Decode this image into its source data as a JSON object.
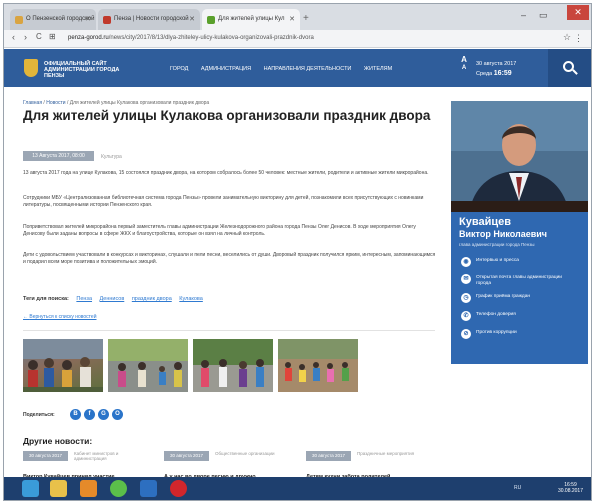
{
  "browser": {
    "tabs": [
      {
        "title": "О Пензенской городской",
        "favicon_color": "#d9a441"
      },
      {
        "title": "Пенза | Новости городской",
        "favicon_color": "#c0392b"
      },
      {
        "title": "Для жителей улицы Кул",
        "favicon_color": "#5aa02c"
      }
    ],
    "new_tab": "+",
    "window_controls": {
      "minimize": "–",
      "maximize": "▭",
      "close": "✕"
    },
    "nav": {
      "back": "‹",
      "forward": "›",
      "reload": "C",
      "home": "⊞",
      "apps": "☆"
    },
    "url_host": "penza-gorod.ru",
    "url_path": "/news/city/2017/8/13/dlya-zhiteley-ulicy-kulakova-organizovali-prazdnik-dvora",
    "menu": "⋮"
  },
  "site": {
    "name_line1": "ОФИЦИАЛЬНЫЙ САЙТ",
    "name_line2": "АДМИНИСТРАЦИИ ГОРОДА",
    "name_line3": "ПЕНЗЫ",
    "nav": [
      "ГОРОД",
      "АДМИНИСТРАЦИЯ",
      "НАПРАВЛЕНИЯ ДЕЯТЕЛЬНОСТИ",
      "ЖИТЕЛЯМ"
    ],
    "font_big": "А",
    "font_small": "А",
    "date": "30 августа 2017",
    "weekday": "Среда",
    "time": "16:59",
    "search_icon": "search-icon"
  },
  "article": {
    "breadcrumb": [
      "Главная",
      "Новости",
      "Для жителей улицы Кулакова организовали праздник двора"
    ],
    "title": "Для жителей улицы Кулакова организовали праздник двора",
    "date": "13 Августа 2017, 08:00",
    "category": "Культура",
    "paragraphs": [
      "13 августа 2017 года на улице Кулакова, 15 состоялся праздник двора, на котором собралось более 50 человек: местные жители, родители и активные жители микрорайона.",
      "Сотрудники МБУ «Централизованная библиотечная система города Пензы» провели занимательную викторину для детей, познакомили всех присутствующих с новинками литературы, посвященными истории Пензенского края.",
      "Поприветствовал жителей микрорайона первый заместитель главы администрации Железнодорожного района города Пензы Олег Денисов. В ходе мероприятия Олегу Денисову были заданы вопросы в сфере ЖКХ и благоустройства, которые он взял на личный контроль.",
      "Дети с удовольствием участвовали в конкурсах и викторинах, слушали и пели песни, веселились от души. Дворовый праздник получился ярким, интересным, запоминающимся и подарил всем море позитива и положительных эмоций."
    ],
    "tags_label": "Теги для поиска:",
    "tags": [
      "Пенза",
      "Деннисов",
      "праздник двора",
      "Кулакова"
    ],
    "back_link": "Вернуться к списку новостей",
    "share_label": "Поделиться:",
    "share_buttons": [
      "В",
      "f",
      "G",
      "О"
    ]
  },
  "other_news": {
    "heading": "Другие новости:",
    "items": [
      {
        "date": "30 августа 2017",
        "category": "Кабинет министров и администрация",
        "title": "Виктор Кувайцев принял участие"
      },
      {
        "date": "30 августа 2017",
        "category": "Общественные организации",
        "title": "А у нас во дворе песню и дружно"
      },
      {
        "date": "30 августа 2017",
        "category": "Праздничные мероприятия",
        "title": "Детям кухни забота родителей"
      }
    ]
  },
  "sidebar": {
    "surname": "Кувайцев",
    "name": "Виктор Николаевич",
    "role": "глава администрации города Пензы",
    "items": [
      {
        "icon": "microphone-icon",
        "label": "Интервью и пресса"
      },
      {
        "icon": "envelope-icon",
        "label": "Открытая почта главы администрации города"
      },
      {
        "icon": "calendar-icon",
        "label": "График приёма граждан"
      },
      {
        "icon": "phone-icon",
        "label": "Телефон доверия"
      },
      {
        "icon": "shield-icon",
        "label": "Против коррупции"
      }
    ],
    "item_glyphs": [
      "◉",
      "✉",
      "◷",
      "✆",
      "⊘"
    ]
  },
  "taskbar": {
    "apps": [
      "start-button-icon",
      "explorer-icon",
      "media-player-icon",
      "chrome-icon",
      "word-icon",
      "opera-icon"
    ],
    "app_colors": [
      "#3a9bd8",
      "#e8c14a",
      "#e58a2a",
      "#5bbf4a",
      "#2d6fc0",
      "#d1262c"
    ],
    "clock_time": "16:59",
    "clock_date": "30.08.2017",
    "lang": "RU"
  }
}
